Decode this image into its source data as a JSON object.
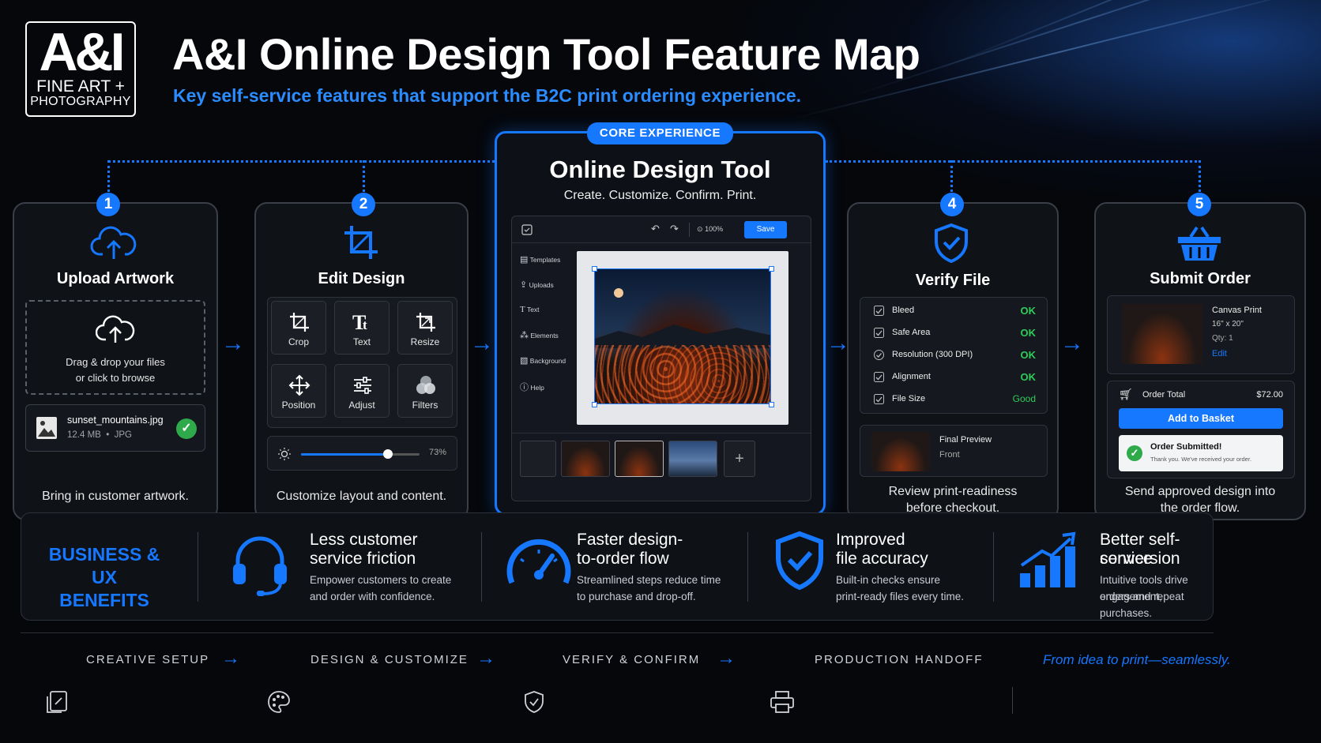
{
  "brand": {
    "logo_mark": "A&I",
    "logo_line1": "FINE ART +",
    "logo_line2": "PHOTOGRAPHY",
    "accent_color": "#1677ff",
    "success_color": "#2eaa4a"
  },
  "header": {
    "title": "A&I Online Design Tool Feature Map",
    "subtitle": "Key self-service features that support the B2C print ordering experience."
  },
  "steps": {
    "upload": {
      "number": "1",
      "title": "Upload Artwork",
      "drop_line1": "Drag & drop your files",
      "drop_line2": "or click to browse",
      "file_name": "sunset_mountains.jpg",
      "file_size": "12.4 MB",
      "file_type": "JPG",
      "footer": "Bring in customer artwork."
    },
    "edit": {
      "number": "2",
      "title": "Edit Design",
      "tools": [
        "Crop",
        "Text",
        "Resize",
        "Position",
        "Adjust",
        "Filters"
      ],
      "slider_value": "73%",
      "slider_fraction": 0.73,
      "footer": "Customize layout and content."
    },
    "verify": {
      "number": "4",
      "title": "Verify File",
      "checks": [
        {
          "name": "Bleed",
          "status": "OK"
        },
        {
          "name": "Safe Area",
          "status": "OK"
        },
        {
          "name": "Resolution (300 DPI)",
          "status": "OK"
        },
        {
          "name": "Alignment",
          "status": "OK"
        },
        {
          "name": "File Size",
          "status": "Good"
        }
      ],
      "preview_title": "Final Preview",
      "preview_side": "Front",
      "footer_line1": "Review print-readiness",
      "footer_line2": "before checkout."
    },
    "submit": {
      "number": "5",
      "title": "Submit Order",
      "product": "Canvas Print",
      "size": "16\" x 20\"",
      "qty": "Qty: 1",
      "edit_link": "Edit",
      "total_label": "Order Total",
      "total_value": "$72.00",
      "add_button": "Add to Basket",
      "submitted_title": "Order Submitted!",
      "submitted_desc": "Thank you. We've received your order.",
      "footer_line1": "Send approved design into",
      "footer_line2": "the order flow."
    }
  },
  "core": {
    "badge": "CORE EXPERIENCE",
    "title": "Online Design Tool",
    "tagline": "Create. Customize. Confirm. Print.",
    "zoom": "100%",
    "save_label": "Save",
    "sidebar": [
      "Templates",
      "Uploads",
      "Text",
      "Elements",
      "Background",
      "Help"
    ],
    "add_icon": "plus-icon"
  },
  "benefits": {
    "heading_line1": "BUSINESS &",
    "heading_line2": "UX BENEFITS",
    "items": [
      {
        "title1": "Less customer",
        "title2": "service friction",
        "desc1": "Empower customers to create",
        "desc2": "and order with confidence.",
        "icon": "headset-icon"
      },
      {
        "title1": "Faster design-",
        "title2": "to-order flow",
        "desc1": "Streamlined steps reduce time",
        "desc2": "to purchase and drop-off.",
        "icon": "speedometer-icon"
      },
      {
        "title1": "Improved",
        "title2": "file accuracy",
        "desc1": "Built-in checks ensure",
        "desc2": "print-ready files every time.",
        "icon": "shield-check-icon"
      },
      {
        "title1": "Better self-service",
        "title2": "conversion",
        "desc1": "Intuitive tools drive engagement,",
        "desc2": "orders and repeat purchases.",
        "icon": "growth-chart-icon"
      }
    ]
  },
  "footer": {
    "stages": [
      "CREATIVE SETUP",
      "DESIGN & CUSTOMIZE",
      "VERIFY & CONFIRM",
      "PRODUCTION HANDOFF"
    ],
    "tagline": "From idea to print—seamlessly."
  }
}
